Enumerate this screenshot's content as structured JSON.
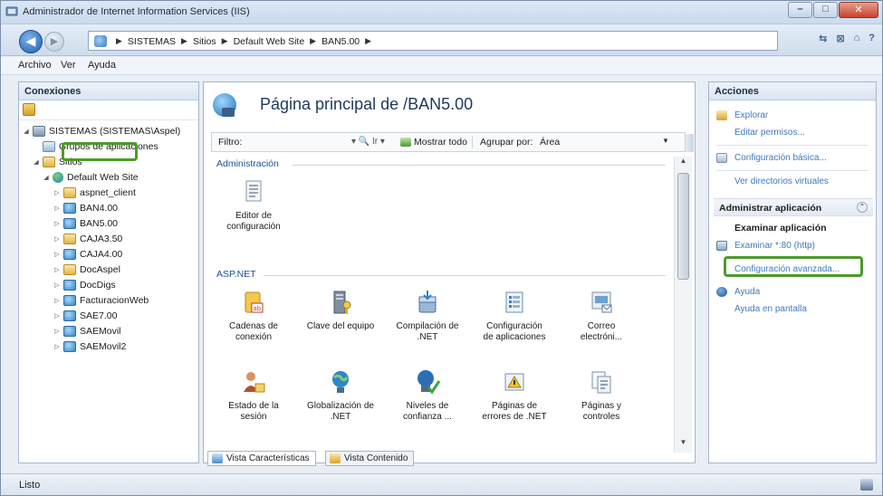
{
  "window": {
    "title": "Administrador de Internet Information Services (IIS)"
  },
  "address": {
    "crumbs": [
      "SISTEMAS",
      "Sitios",
      "Default Web Site",
      "BAN5.00"
    ]
  },
  "menu": {
    "items": [
      "Archivo",
      "Ver",
      "Ayuda"
    ]
  },
  "connections": {
    "header": "Conexiones",
    "tree": [
      {
        "label": "SISTEMAS (SISTEMAS\\Aspel)",
        "icon": "server-icon"
      },
      {
        "label": "Grupos de aplicaciones",
        "icon": "app-pool-icon"
      },
      {
        "label": "Sitios",
        "icon": "sites-folder-icon"
      },
      {
        "label": "Default Web Site",
        "icon": "globe-icon"
      },
      {
        "label": "aspnet_client",
        "icon": "folder-icon"
      },
      {
        "label": "BAN4.00",
        "icon": "web-app-icon"
      },
      {
        "label": "BAN5.00",
        "icon": "web-app-icon"
      },
      {
        "label": "CAJA3.50",
        "icon": "folder-icon"
      },
      {
        "label": "CAJA4.00",
        "icon": "web-app-icon"
      },
      {
        "label": "DocAspel",
        "icon": "folder-icon"
      },
      {
        "label": "DocDigs",
        "icon": "web-app-icon"
      },
      {
        "label": "FacturacionWeb",
        "icon": "web-app-icon"
      },
      {
        "label": "SAE7.00",
        "icon": "web-app-icon"
      },
      {
        "label": "SAEMovil",
        "icon": "web-app-icon"
      },
      {
        "label": "SAEMovil2",
        "icon": "web-app-icon"
      }
    ]
  },
  "main": {
    "title": "Página principal de /BAN5.00",
    "filter_label": "Filtro:",
    "filter_go": "▾ 🔍 Ir ▾",
    "show_all": "Mostrar todo",
    "group_by_label": "Agrupar por:",
    "group_by_value": "Área",
    "sections": [
      {
        "name": "Administración",
        "features": [
          {
            "l1": "Editor de",
            "l2": "configuración",
            "icon": "config-editor-icon"
          }
        ]
      },
      {
        "name": "ASP.NET",
        "features": [
          {
            "l1": "Cadenas de",
            "l2": "conexión",
            "icon": "connection-strings-icon"
          },
          {
            "l1": "Clave del equipo",
            "l2": "",
            "icon": "machine-key-icon"
          },
          {
            "l1": "Compilación de",
            "l2": ".NET",
            "icon": "net-compilation-icon"
          },
          {
            "l1": "Configuración",
            "l2": "de aplicaciones",
            "icon": "app-settings-icon"
          },
          {
            "l1": "Correo",
            "l2": "electróni...",
            "icon": "smtp-email-icon"
          },
          {
            "l1": "Estado de la",
            "l2": "sesión",
            "icon": "session-state-icon"
          },
          {
            "l1": "Globalización de",
            "l2": ".NET",
            "icon": "net-globalization-icon"
          },
          {
            "l1": "Niveles de",
            "l2": "confianza ...",
            "icon": "trust-levels-icon"
          },
          {
            "l1": "Páginas de",
            "l2": "errores de .NET",
            "icon": "net-error-pages-icon"
          },
          {
            "l1": "Páginas y",
            "l2": "controles",
            "icon": "pages-controls-icon"
          }
        ]
      }
    ],
    "view_tabs": [
      "Vista Características",
      "Vista Contenido"
    ]
  },
  "actions": {
    "header": "Acciones",
    "explore": "Explorar",
    "edit_permissions": "Editar permisos...",
    "basic_settings": "Configuración básica...",
    "virtual_dirs": "Ver directorios virtuales",
    "manage_app": "Administrar aplicación",
    "browse_app": "Examinar aplicación",
    "browse_port": "Examinar *:80 (http)",
    "advanced_settings": "Configuración avanzada...",
    "help": "Ayuda",
    "online_help": "Ayuda en pantalla"
  },
  "status": {
    "text": "Listo"
  },
  "colors": {
    "highlight": "#4c9a2a",
    "link": "#3f79bd"
  }
}
